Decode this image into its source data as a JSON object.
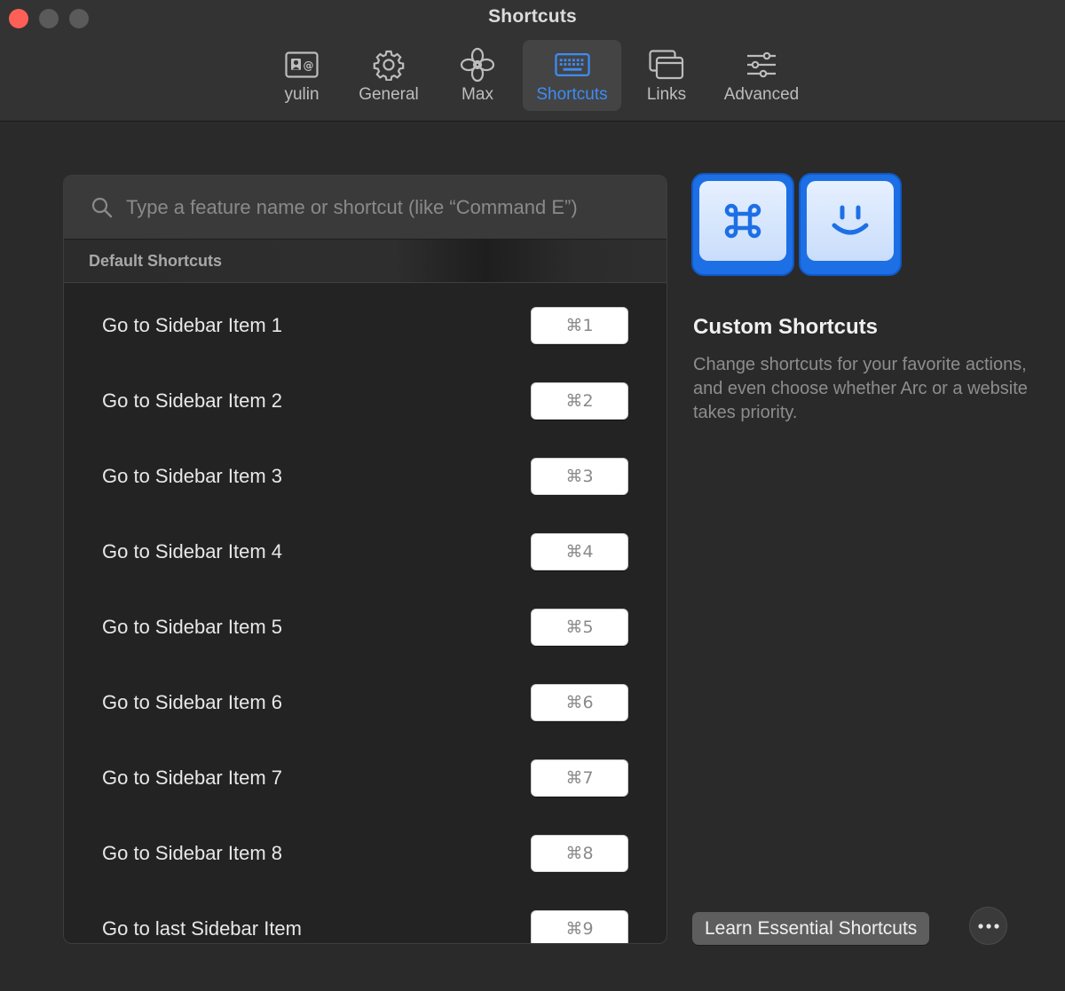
{
  "window": {
    "title": "Shortcuts"
  },
  "tabs": [
    {
      "label": "yulin",
      "icon": "contact-card-icon",
      "active": false
    },
    {
      "label": "General",
      "icon": "gear-icon",
      "active": false
    },
    {
      "label": "Max",
      "icon": "flower-icon",
      "active": false
    },
    {
      "label": "Shortcuts",
      "icon": "keyboard-icon",
      "active": true
    },
    {
      "label": "Links",
      "icon": "windows-icon",
      "active": false
    },
    {
      "label": "Advanced",
      "icon": "sliders-icon",
      "active": false
    }
  ],
  "search": {
    "placeholder": "Type a feature name or shortcut (like “Command E”)",
    "value": ""
  },
  "section": {
    "header": "Default Shortcuts"
  },
  "shortcuts": [
    {
      "label": "Go to Sidebar Item 1",
      "key": "⌘1"
    },
    {
      "label": "Go to Sidebar Item 2",
      "key": "⌘2"
    },
    {
      "label": "Go to Sidebar Item 3",
      "key": "⌘3"
    },
    {
      "label": "Go to Sidebar Item 4",
      "key": "⌘4"
    },
    {
      "label": "Go to Sidebar Item 5",
      "key": "⌘5"
    },
    {
      "label": "Go to Sidebar Item 6",
      "key": "⌘6"
    },
    {
      "label": "Go to Sidebar Item 7",
      "key": "⌘7"
    },
    {
      "label": "Go to Sidebar Item 8",
      "key": "⌘8"
    },
    {
      "label": "Go to last Sidebar Item",
      "key": "⌘9"
    }
  ],
  "custom": {
    "title": "Custom Shortcuts",
    "description": "Change shortcuts for your favorite actions, and even choose whether Arc or a website takes priority.",
    "hero_icons": [
      "command-key-icon",
      "smiley-key-icon"
    ]
  },
  "footer": {
    "learn_label": "Learn Essential Shortcuts",
    "more_icon": "ellipsis-icon"
  },
  "colors": {
    "accent": "#3d8cf5",
    "key_blue": "#1d6fe6",
    "close": "#fe5f57"
  }
}
